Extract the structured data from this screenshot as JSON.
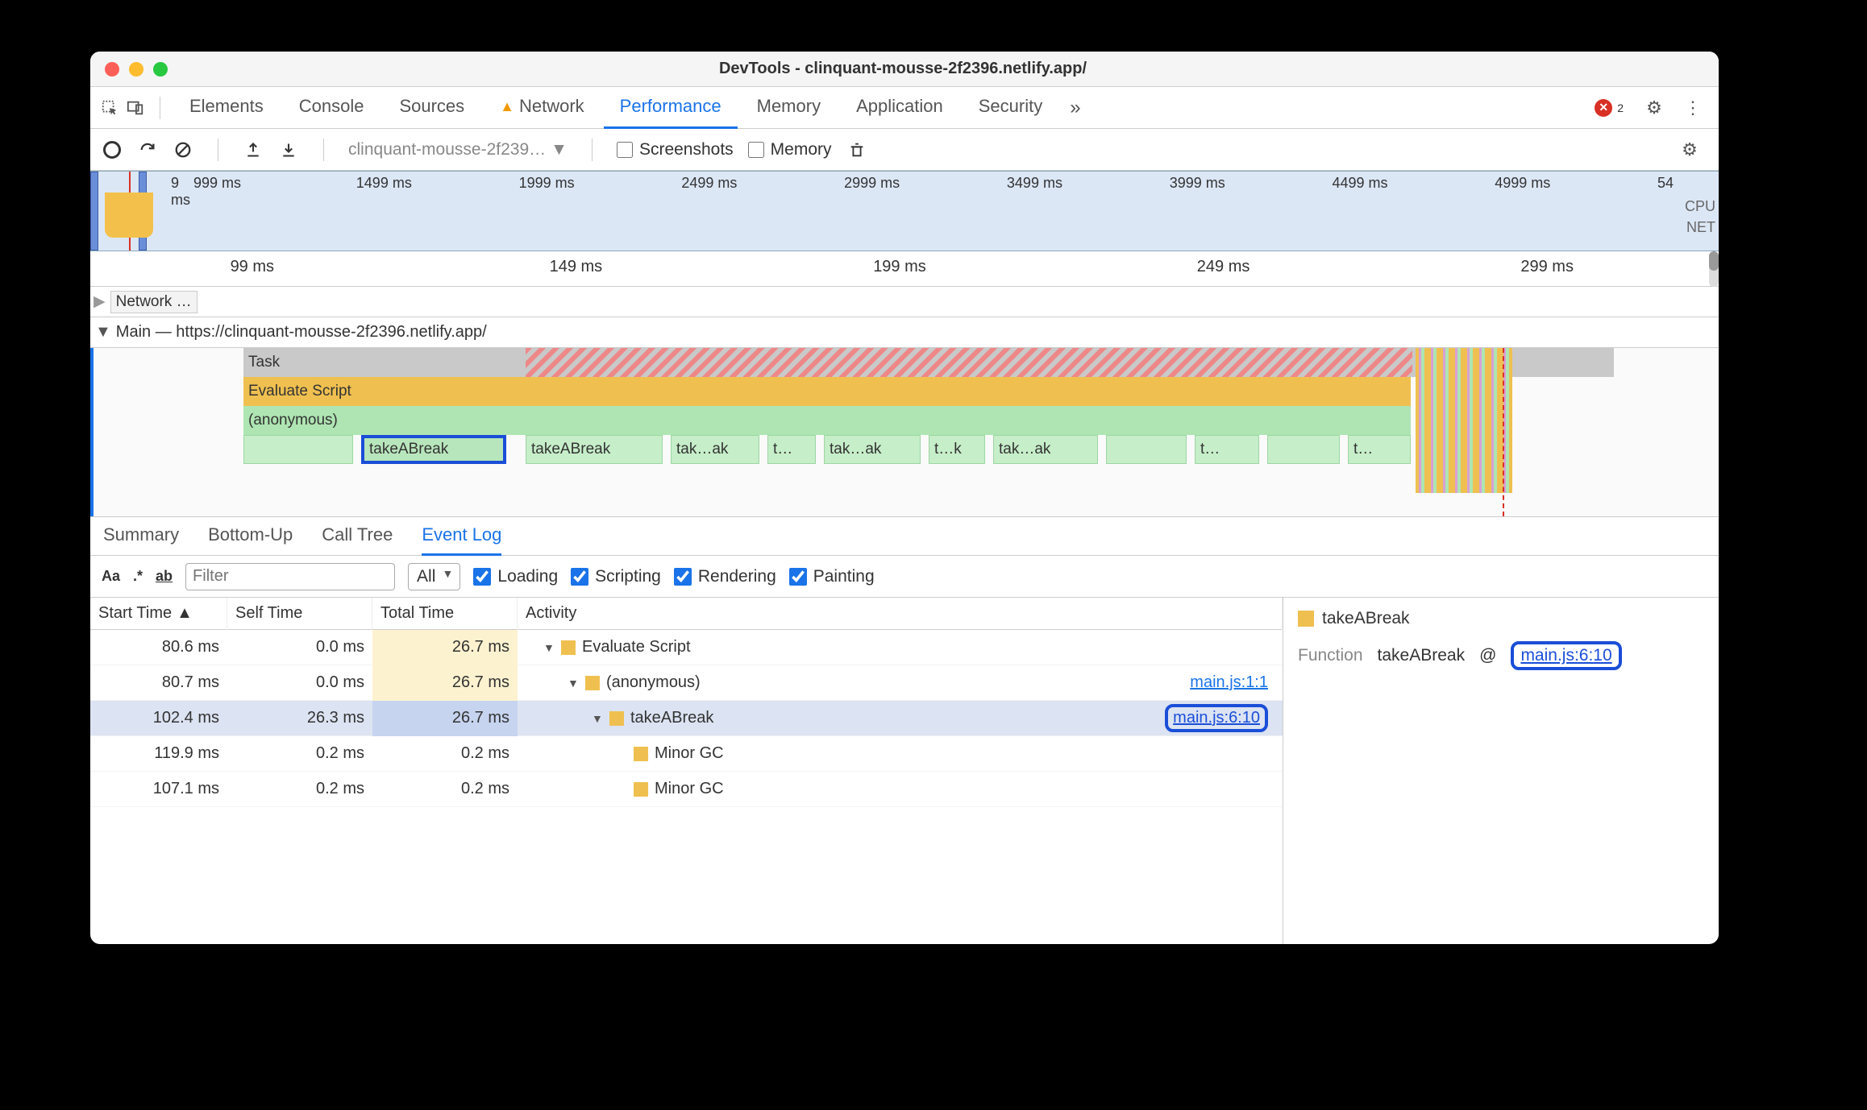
{
  "window": {
    "title": "DevTools - clinquant-mousse-2f2396.netlify.app/"
  },
  "tabs": {
    "items": [
      "Elements",
      "Console",
      "Sources",
      "Network",
      "Performance",
      "Memory",
      "Application",
      "Security"
    ],
    "active": "Performance",
    "warning_on": "Network",
    "more": "»",
    "errors": "2"
  },
  "toolbar": {
    "url_label": "clinquant-mousse-2f239…",
    "screenshots": "Screenshots",
    "memory": "Memory"
  },
  "overview": {
    "ticks": [
      "9 ms",
      "999 ms",
      "1499 ms",
      "1999 ms",
      "2499 ms",
      "2999 ms",
      "3499 ms",
      "3999 ms",
      "4499 ms",
      "4999 ms",
      "54"
    ],
    "right_labels": [
      "CPU",
      "NET"
    ]
  },
  "ruler_ticks": [
    "99 ms",
    "149 ms",
    "199 ms",
    "249 ms",
    "299 ms"
  ],
  "network_row": "Network …",
  "main_label": "Main — https://clinquant-mousse-2f2396.netlify.app/",
  "flame": {
    "task": "Task",
    "eval": "Evaluate Script",
    "anon": "(anonymous)",
    "fns": [
      "takeABreak",
      "takeABreak",
      "tak…ak",
      "t…",
      "tak…ak",
      "t…k",
      "tak…ak",
      "t…",
      "t…"
    ]
  },
  "subtabs": {
    "items": [
      "Summary",
      "Bottom-Up",
      "Call Tree",
      "Event Log"
    ],
    "active": "Event Log"
  },
  "filter": {
    "aa": "Aa",
    "re": ".*",
    "ab": "ab",
    "placeholder": "Filter",
    "all": "All",
    "cats": [
      "Loading",
      "Scripting",
      "Rendering",
      "Painting"
    ]
  },
  "table": {
    "headers": {
      "start": "Start Time",
      "self": "Self Time",
      "total": "Total Time",
      "activity": "Activity"
    },
    "rows": [
      {
        "start": "80.6 ms",
        "self": "0.0 ms",
        "total": "26.7 ms",
        "tt_hl": "hl1",
        "indent": 0,
        "disclose": "▼",
        "name": "Evaluate Script",
        "link": ""
      },
      {
        "start": "80.7 ms",
        "self": "0.0 ms",
        "total": "26.7 ms",
        "tt_hl": "hl1",
        "indent": 1,
        "disclose": "▼",
        "name": "(anonymous)",
        "link": "main.js:1:1",
        "linkboxed": false
      },
      {
        "start": "102.4 ms",
        "self": "26.3 ms",
        "total": "26.7 ms",
        "tt_hl": "hl2",
        "indent": 2,
        "disclose": "▼",
        "name": "takeABreak",
        "link": "main.js:6:10",
        "linkboxed": true,
        "selected": true
      },
      {
        "start": "119.9 ms",
        "self": "0.2 ms",
        "total": "0.2 ms",
        "tt_hl": "",
        "indent": 3,
        "disclose": "",
        "name": "Minor GC",
        "link": ""
      },
      {
        "start": "107.1 ms",
        "self": "0.2 ms",
        "total": "0.2 ms",
        "tt_hl": "",
        "indent": 3,
        "disclose": "",
        "name": "Minor GC",
        "link": ""
      }
    ]
  },
  "details": {
    "title": "takeABreak",
    "func_label": "Function",
    "func_name": "takeABreak",
    "at": "@",
    "link": "main.js:6:10"
  }
}
